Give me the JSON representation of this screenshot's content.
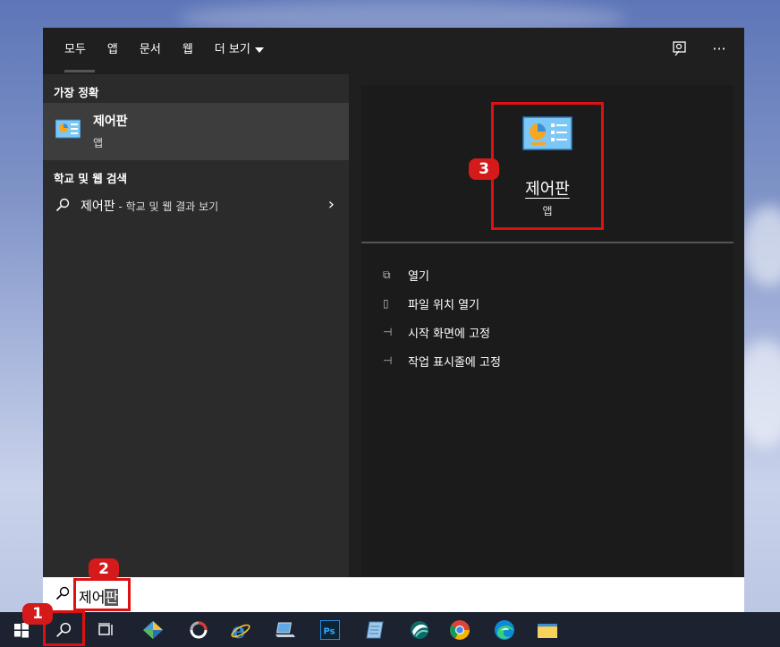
{
  "tabs": [
    {
      "label": "모두",
      "active": true
    },
    {
      "label": "앱"
    },
    {
      "label": "문서"
    },
    {
      "label": "웹"
    },
    {
      "label": "더 보기"
    }
  ],
  "left": {
    "best_match_heading": "가장 정확",
    "best_match": {
      "name": "제어판",
      "type": "앱"
    },
    "web_heading": "학교 및 웹 검색",
    "web_result": {
      "query": "제어판",
      "suffix": " - 학교 및 웹 결과 보기"
    }
  },
  "preview": {
    "name": "제어판",
    "type": "앱",
    "actions": [
      "열기",
      "파일 위치 열기",
      "시작 화면에 고정",
      "작업 표시줄에 고정"
    ]
  },
  "search": {
    "typed": "제어",
    "selected": "판"
  },
  "badges": {
    "b1": "1",
    "b2": "2",
    "b3": "3"
  },
  "taskbar": {
    "icons": [
      "windows-icon",
      "search-icon",
      "task-view-icon",
      "network-app-icon",
      "cortana-ring-icon",
      "internet-explorer-icon",
      "laptop-icon",
      "photoshop-icon",
      "notepad-icon",
      "snipping-icon",
      "chrome-icon",
      "edge-icon",
      "file-explorer-icon"
    ],
    "ps_label": "Ps"
  },
  "colors": {
    "annotation": "#d41a1a",
    "panel": "#1f1f1f",
    "taskbar": "#1c2230"
  }
}
